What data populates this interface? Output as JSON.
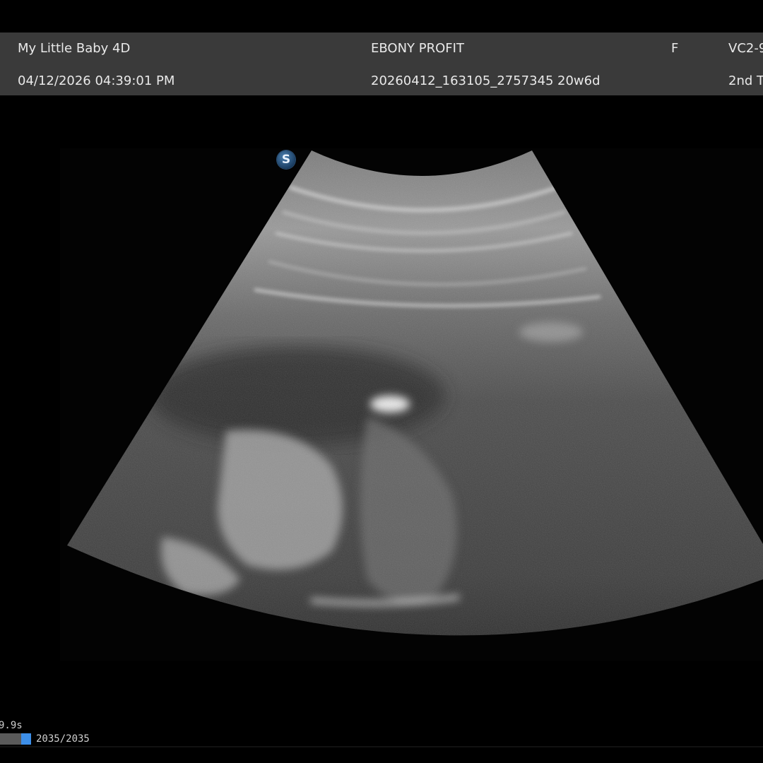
{
  "header": {
    "app_name": "My Little Baby 4D",
    "datetime": "04/12/2026 04:39:01 PM",
    "patient_name": "EBONY PROFIT",
    "exam_id": "20260412_163105_2757345",
    "gestational_age": "20w6d",
    "sex": "F",
    "probe": "VC2-9",
    "trimester": "2nd T"
  },
  "badge": {
    "label": "S",
    "color": "#2b5f92"
  },
  "cine": {
    "elapsed": "9.9s",
    "frames": "2035/2035",
    "position_fraction": 1.0,
    "accent_color": "#3d8fe8"
  }
}
